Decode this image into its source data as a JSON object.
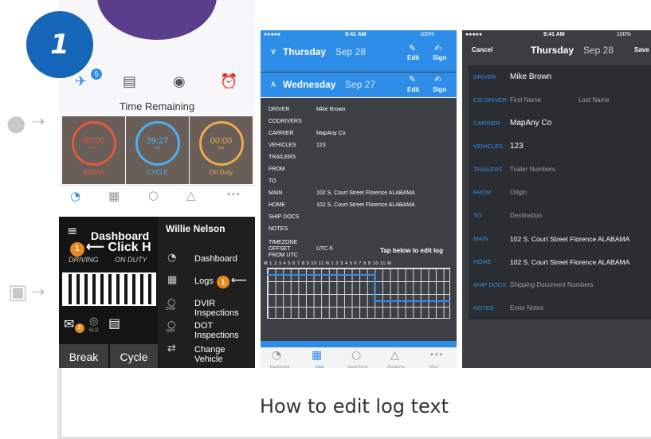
{
  "step": {
    "number": "1"
  },
  "caption": "How to edit log text",
  "ios_dashboard": {
    "badge_count": "5",
    "time_remaining": "Time Remaining",
    "gauges": [
      {
        "time": "00:00",
        "unit": "hrs",
        "label": "BREAK",
        "color": "#e0472a"
      },
      {
        "time": "39:27",
        "unit": "hrs",
        "label": "CYCLE",
        "color": "#3ba8f0"
      },
      {
        "time": "00:00",
        "unit": "hrs",
        "label": "On Duty",
        "color": "#e9a23b"
      }
    ],
    "tab_more": "•••"
  },
  "android": {
    "title": "Dashboard",
    "click_here": "Click H",
    "driving": "DRIVING",
    "on_duty": "ON DUTY",
    "badge1": "1",
    "badge2": "2",
    "badge3": "1",
    "eld": "ELD",
    "break_btn": "Break",
    "cycle_btn": "Cycle",
    "drawer_user": "Willie Nelson",
    "drawer_items": [
      {
        "label": "Dashboard",
        "sub": ""
      },
      {
        "label": "Logs",
        "sub": ""
      },
      {
        "label": "DVIR Inspections",
        "sub": "DVIR"
      },
      {
        "label": "DOT Inspections",
        "sub": "DOT"
      },
      {
        "label": "Change Vehicle",
        "sub": ""
      }
    ]
  },
  "ios_logs": {
    "status_signal": "●●●●● ",
    "status_time": "9:41 AM",
    "status_battery": "100%",
    "day1_name": "Thursday",
    "day1_date": "Sep 28",
    "day2_name": "Wednesday",
    "day2_date": "Sep 27",
    "edit": "Edit",
    "sign": "Sign",
    "rows": [
      {
        "label": "DRIVER",
        "value": "Mike Brown"
      },
      {
        "label": "CODRIVERS",
        "value": ""
      },
      {
        "label": "CARRIER",
        "value": "MapAny Co"
      },
      {
        "label": "VEHICLES",
        "value": "123"
      },
      {
        "label": "TRAILERS",
        "value": ""
      },
      {
        "label": "FROM",
        "value": ""
      },
      {
        "label": "TO",
        "value": ""
      },
      {
        "label": "MAIN",
        "value": "102 S. Court Street Florence ALABAMA"
      },
      {
        "label": "HOME",
        "value": "102 S. Court Street Florence ALABAMA"
      },
      {
        "label": "SHIP DOCS",
        "value": ""
      },
      {
        "label": "NOTES",
        "value": ""
      }
    ],
    "timezone_label1": "TIMEZONE",
    "timezone_label2": "OFFSET",
    "timezone_label3": "FROM UTC",
    "timezone_value": "UTC-5",
    "tap_hint": "Tap below to edit log",
    "hours": "M 1 2 3 4 5 6 7 8 9 10 11 N 1 2 3 4 5 6 7 8 9 10 11 M",
    "tabs": [
      "Dashboard",
      "Logs",
      "Inspections",
      "Accidents",
      "More"
    ]
  },
  "ios_edit": {
    "status_time": "9:41 AM",
    "status_battery": "100%",
    "cancel": "Cancel",
    "day_name": "Thursday",
    "day_date": "Sep 28",
    "save": "Save",
    "fields": [
      {
        "label": "DRIVER",
        "value": "Mike Brown",
        "placeholder": ""
      },
      {
        "label": "CO-DRIVER",
        "value": "",
        "placeholder": "First Name",
        "placeholder2": "Last Name"
      },
      {
        "label": "CARRIER",
        "value": "MapAny Co",
        "placeholder": ""
      },
      {
        "label": "VEHICLES",
        "value": "123",
        "placeholder": ""
      },
      {
        "label": "TRAILERS",
        "value": "",
        "placeholder": "Trailer Numbers"
      },
      {
        "label": "FROM",
        "value": "",
        "placeholder": "Origin"
      },
      {
        "label": "TO",
        "value": "",
        "placeholder": "Destination"
      },
      {
        "label": "MAIN",
        "value": "102 S. Court Street Florence ALABAMA",
        "placeholder": ""
      },
      {
        "label": "HOME",
        "value": "102 S. Court Street Florence ALABAMA",
        "placeholder": ""
      },
      {
        "label": "SHIP DOCS",
        "value": "",
        "placeholder": "Shipping Document Numbers"
      },
      {
        "label": "NOTES",
        "value": "",
        "placeholder": "Enter Notes"
      }
    ]
  }
}
